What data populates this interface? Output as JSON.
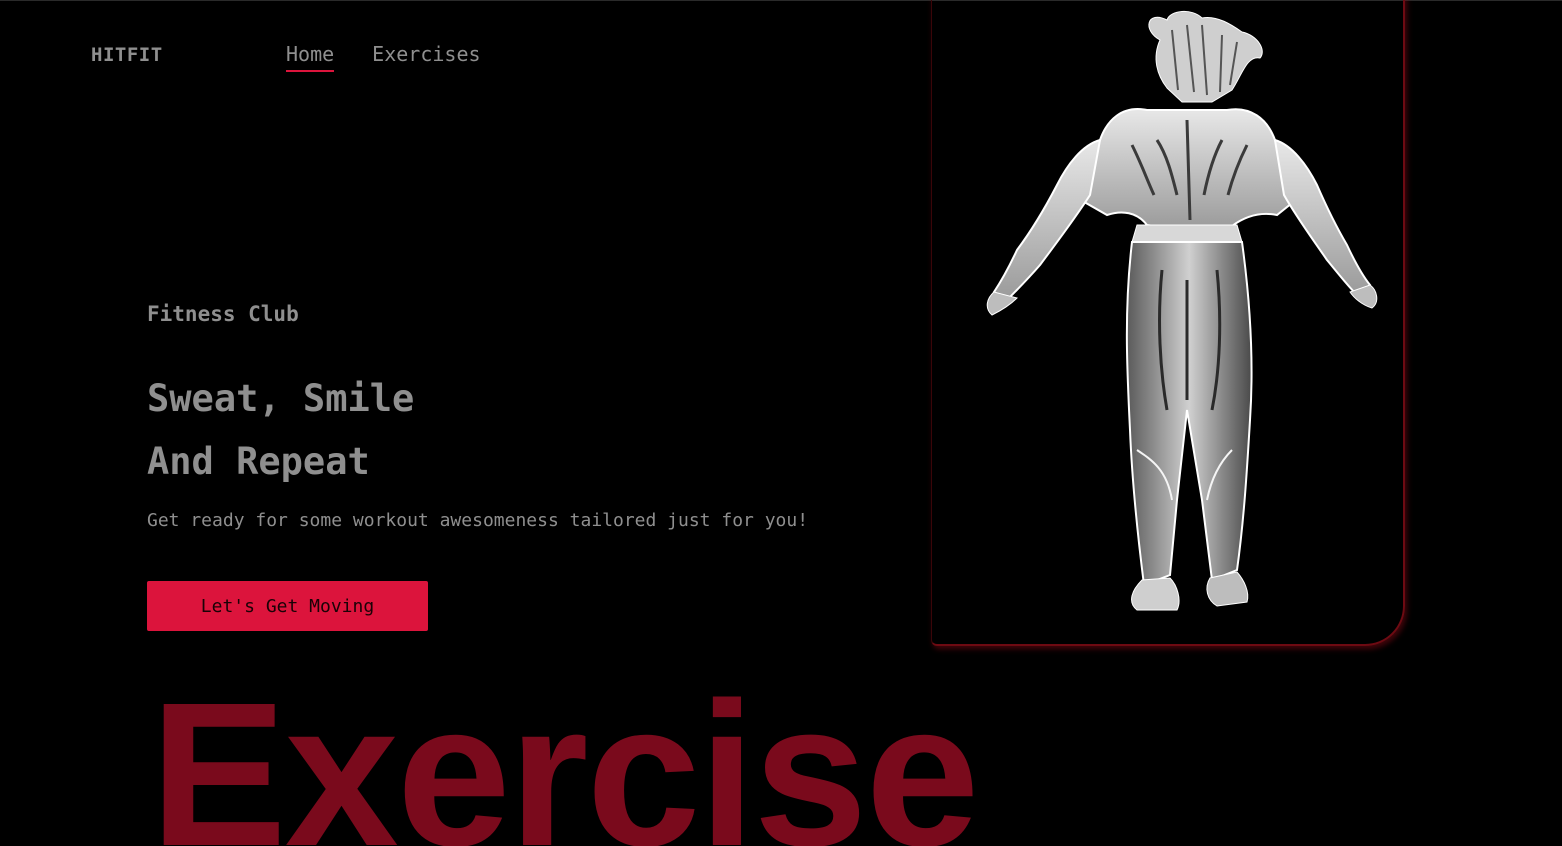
{
  "header": {
    "logo": "HITFIT",
    "nav": [
      {
        "label": "Home",
        "active": true
      },
      {
        "label": "Exercises",
        "active": false
      }
    ]
  },
  "hero": {
    "subtitle": "Fitness Club",
    "headline_line1": "Sweat, Smile",
    "headline_line2": "And Repeat",
    "tagline": "Get ready for some workout awesomeness tailored just for you!",
    "cta_label": "Let's Get Moving",
    "image_description_icon": "muscular-figure-back-view-illustration"
  },
  "banner": {
    "text": "Exercise"
  },
  "colors": {
    "background": "#000000",
    "text": "#8f8f8f",
    "accent": "#dc143c",
    "banner": "#7a0a1c"
  }
}
